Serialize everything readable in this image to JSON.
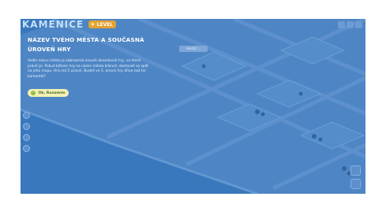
{
  "game": {
    "city_name": "KAMENICE",
    "level_badge": "LEVEL"
  },
  "tutorial": {
    "title_line1": "NÁZEV TVÉHO MĚSTA A SOUČASNÁ",
    "title_line2": "ÚROVEŇ HRY",
    "body": "Vedle názvu města je zobrazená úroveň dovednosti hry, ve které právě jsi. Pokud během hry na název města klikneš, dostaneš se zpět na jeho mapu. Hra má 5 úrovní. Budeš ve 5. úrovni hry dříve než tví kamarádi?",
    "ok_label": "Ok, Rozumím"
  },
  "map": {
    "search_label": "Hledat ..."
  },
  "colors": {
    "water": "#3f84c2",
    "grass": "#5f98d0",
    "overlay": "#346eb9",
    "badge": "#e2a231",
    "button": "#f3f0b3"
  }
}
